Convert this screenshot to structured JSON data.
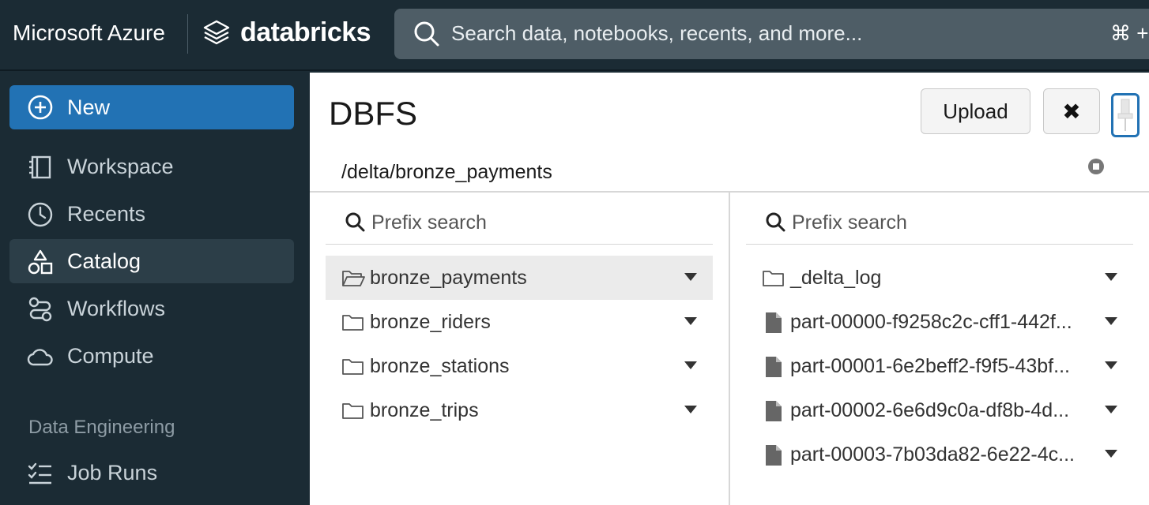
{
  "header": {
    "cloud_brand": "Microsoft Azure",
    "product_brand": "databricks",
    "search_placeholder": "Search data, notebooks, recents, and more...",
    "search_shortcut": "⌘ +"
  },
  "sidebar": {
    "new_label": "New",
    "items": [
      {
        "label": "Workspace",
        "icon": "workspace-icon",
        "active": false
      },
      {
        "label": "Recents",
        "icon": "clock-icon",
        "active": false
      },
      {
        "label": "Catalog",
        "icon": "catalog-icon",
        "active": true
      },
      {
        "label": "Workflows",
        "icon": "workflows-icon",
        "active": false
      },
      {
        "label": "Compute",
        "icon": "cloud-icon",
        "active": false
      }
    ],
    "section_title": "Data Engineering",
    "section_items": [
      {
        "label": "Job Runs",
        "icon": "job-runs-icon"
      }
    ]
  },
  "dbfs": {
    "title": "DBFS",
    "upload_label": "Upload",
    "close_label": "✖",
    "current_path": "/delta/bronze_payments",
    "left_column": {
      "search_placeholder": "Prefix search",
      "items": [
        {
          "name": "bronze_payments",
          "type": "folder-open",
          "selected": true
        },
        {
          "name": "bronze_riders",
          "type": "folder",
          "selected": false
        },
        {
          "name": "bronze_stations",
          "type": "folder",
          "selected": false
        },
        {
          "name": "bronze_trips",
          "type": "folder",
          "selected": false
        }
      ]
    },
    "right_column": {
      "search_placeholder": "Prefix search",
      "items": [
        {
          "name": "_delta_log",
          "type": "folder"
        },
        {
          "name": "part-00000-f9258c2c-cff1-442f...",
          "type": "file"
        },
        {
          "name": "part-00001-6e2beff2-f9f5-43bf...",
          "type": "file"
        },
        {
          "name": "part-00002-6e6d9c0a-df8b-4d...",
          "type": "file"
        },
        {
          "name": "part-00003-7b03da82-6e22-4c...",
          "type": "file"
        }
      ]
    }
  },
  "colors": {
    "sidebar_bg": "#1b2b34",
    "accent": "#2272b4",
    "search_bg": "#4e5d66",
    "selected_row": "#ebebeb"
  }
}
